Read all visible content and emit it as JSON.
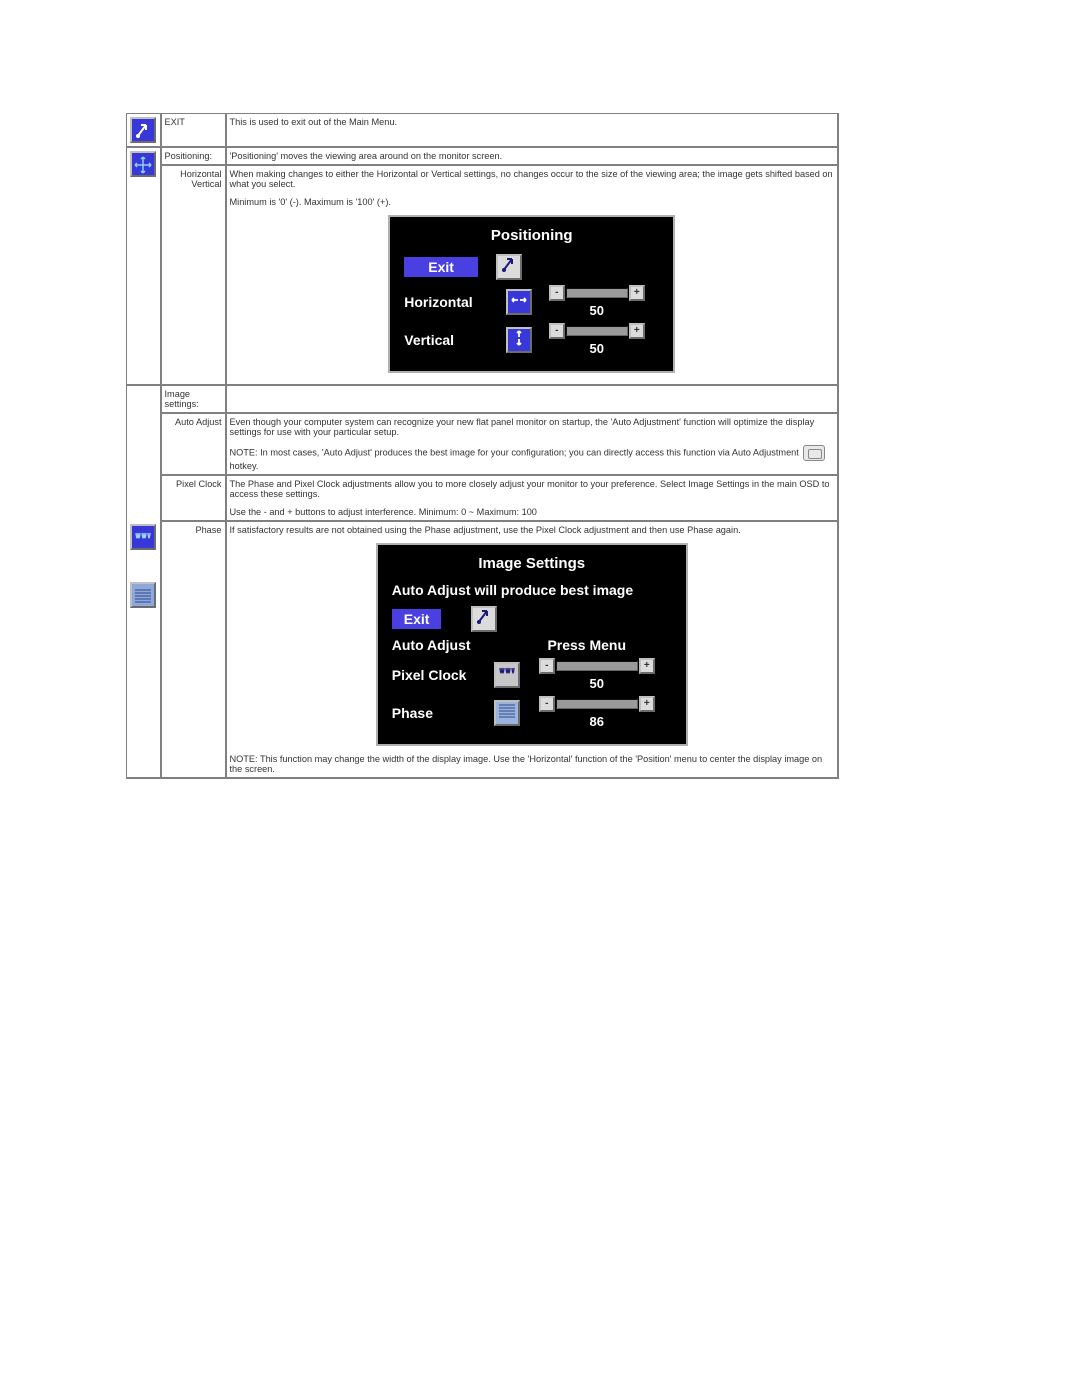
{
  "rows": {
    "exit": {
      "label": "EXIT",
      "desc": "This is used to exit out of the Main Menu."
    },
    "positioning": {
      "label": "Positioning:",
      "desc": "'Positioning' moves the viewing area around on the monitor screen.",
      "hv_label": "Horizontal Vertical",
      "hv_desc1": "When making changes to either the Horizontal or Vertical settings, no changes occur to the size of the viewing area; the image gets shifted based on what you select.",
      "hv_desc2": "Minimum is '0' (-). Maximum is '100' (+)."
    },
    "image": {
      "label": "Image settings:",
      "auto_label": "Auto Adjust",
      "auto_desc1": "Even though your computer system can recognize your new flat panel monitor on startup, the 'Auto Adjustment' function will optimize the display settings for use with your particular setup.",
      "auto_note_pre": "NOTE: In most cases, 'Auto Adjust' produces the best image for your configuration; you can directly access this function via Auto Adjustment ",
      "auto_note_post": " hotkey.",
      "pixel_label": "Pixel Clock",
      "pixel_desc1": "The Phase and Pixel Clock adjustments allow you to more closely adjust your monitor to your preference. Select Image Settings in the main OSD to access these settings.",
      "pixel_desc2": "Use the - and + buttons to adjust interference. Minimum: 0 ~ Maximum: 100",
      "phase_label": "Phase",
      "phase_desc": "If satisfactory results are not obtained using the Phase adjustment, use the Pixel Clock adjustment and then use Phase again.",
      "phase_note": "NOTE: This function may change the width of the display image. Use the 'Horizontal' function of the 'Position' menu to center the display image on the screen."
    }
  },
  "osd_positioning": {
    "title": "Positioning",
    "exit": "Exit",
    "horizontal": {
      "label": "Horizontal",
      "value": "50"
    },
    "vertical": {
      "label": "Vertical",
      "value": "50"
    }
  },
  "osd_image": {
    "title": "Image Settings",
    "subtitle": "Auto Adjust will produce best image",
    "exit": "Exit",
    "auto": {
      "label": "Auto Adjust",
      "right": "Press Menu"
    },
    "pixel": {
      "label": "Pixel Clock",
      "value": "50"
    },
    "phase": {
      "label": "Phase",
      "value": "86"
    }
  }
}
